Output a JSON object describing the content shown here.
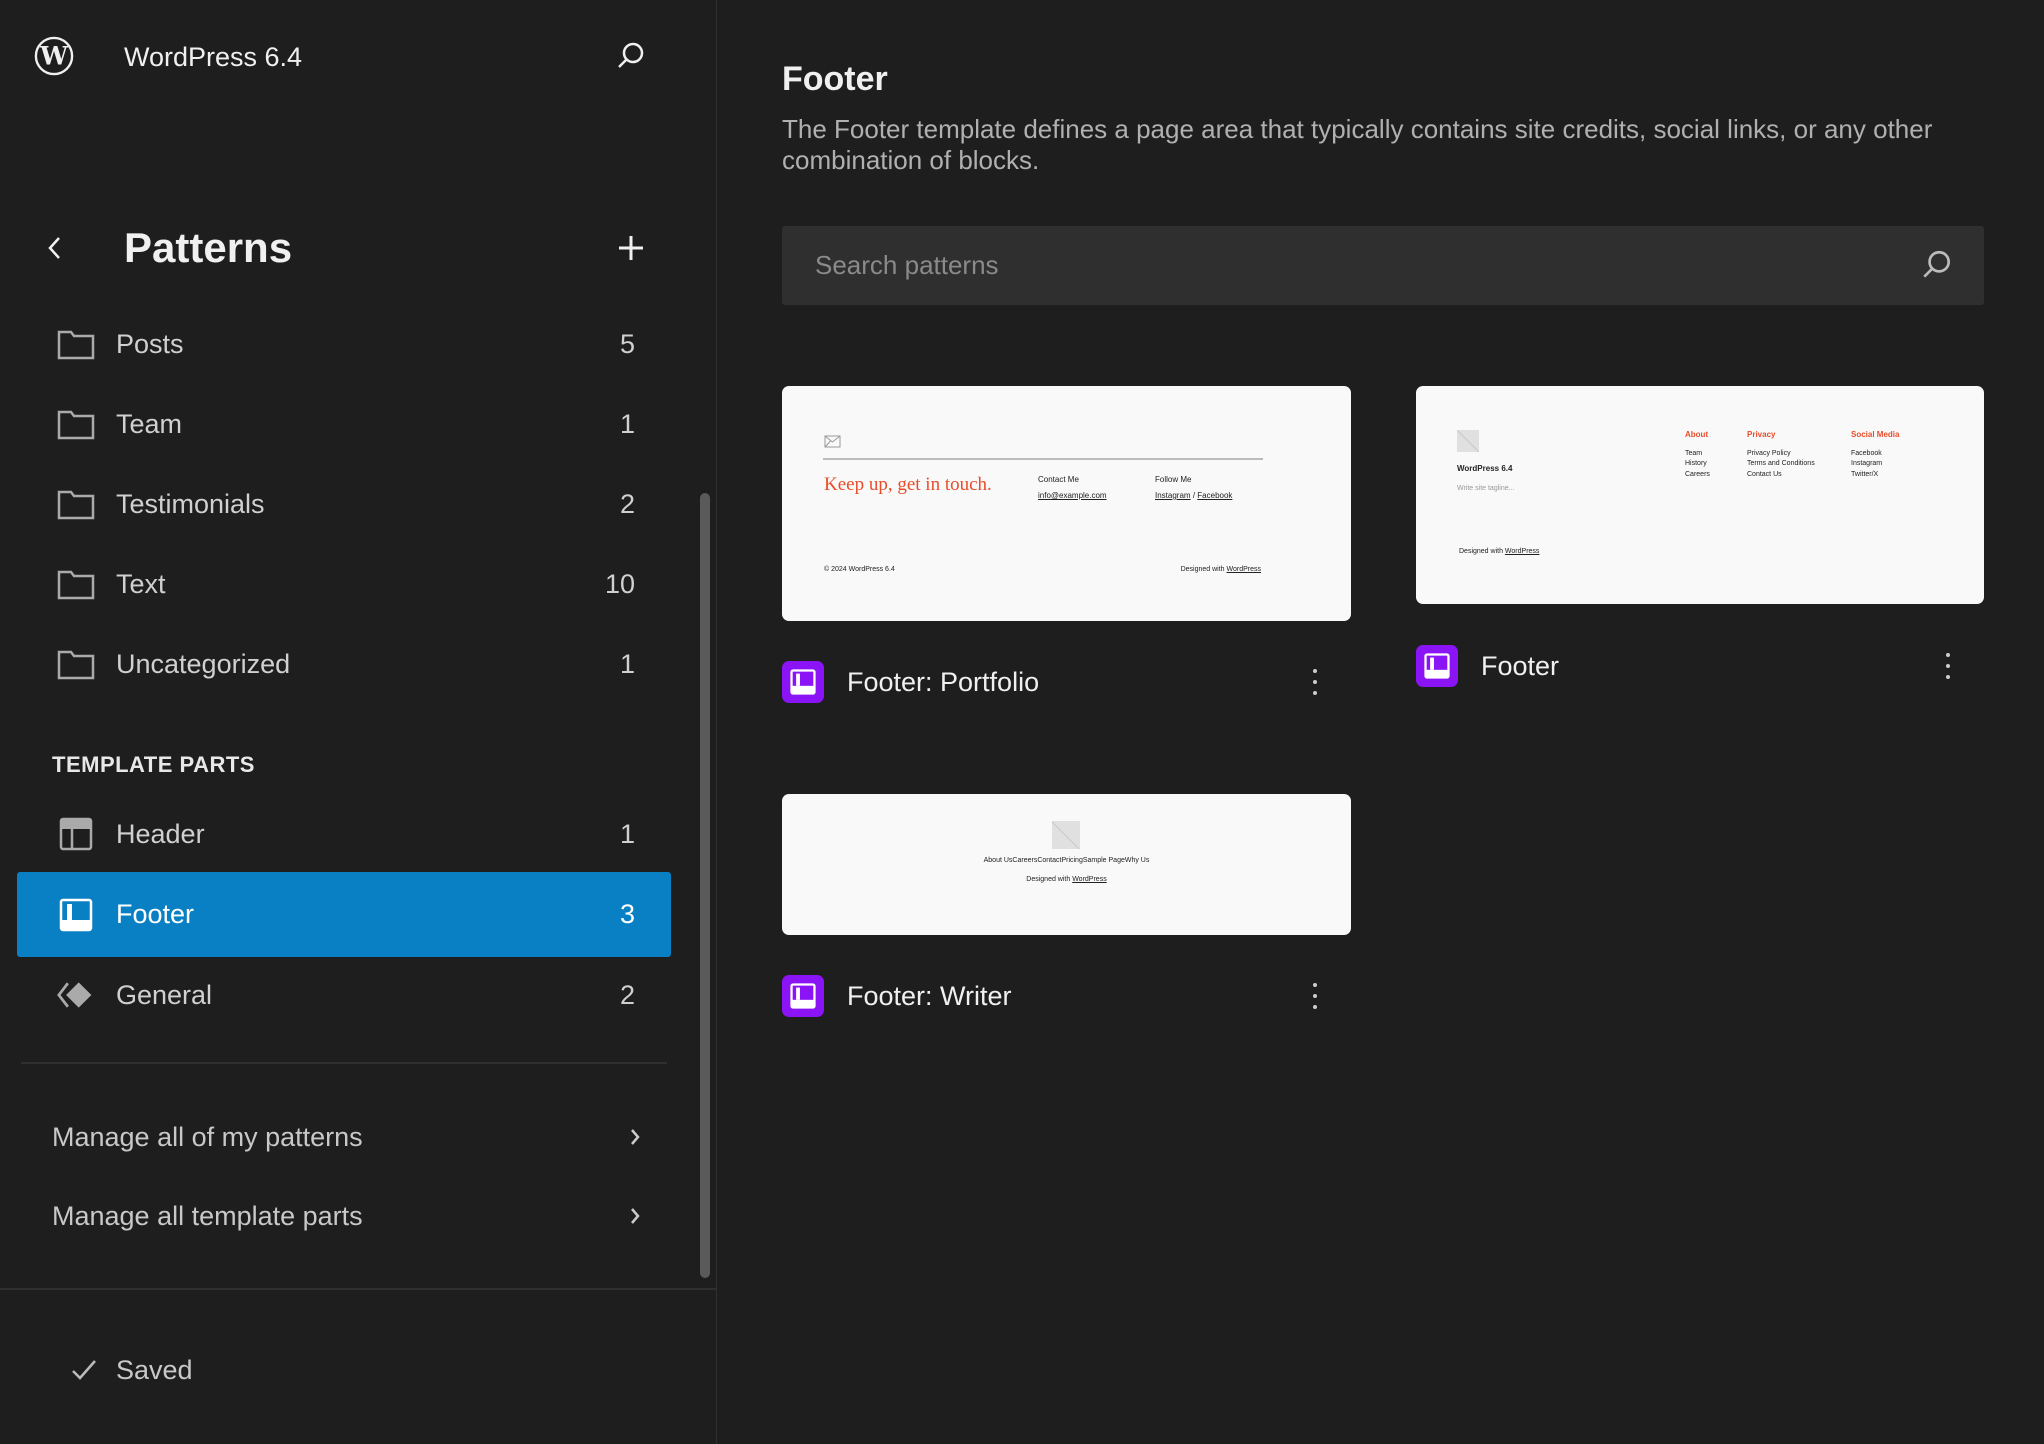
{
  "sidebar": {
    "site_title": "WordPress 6.4",
    "panel_title": "Patterns",
    "categories": [
      {
        "label": "Posts",
        "count": "5"
      },
      {
        "label": "Team",
        "count": "1"
      },
      {
        "label": "Testimonials",
        "count": "2"
      },
      {
        "label": "Text",
        "count": "10"
      },
      {
        "label": "Uncategorized",
        "count": "1"
      }
    ],
    "section_label": "TEMPLATE PARTS",
    "template_parts": [
      {
        "label": "Header",
        "count": "1"
      },
      {
        "label": "Footer",
        "count": "3",
        "active": true
      },
      {
        "label": "General",
        "count": "2"
      }
    ],
    "manage_patterns": "Manage all of my patterns",
    "manage_parts": "Manage all template parts",
    "status": "Saved"
  },
  "main": {
    "title": "Footer",
    "description": "The Footer template defines a page area that typically contains site credits, social links, or any other combination of blocks.",
    "search_placeholder": "Search patterns",
    "accent": "#0a80c4",
    "patterns": [
      {
        "label": "Footer: Portfolio",
        "preview": {
          "heading": "Keep up, get in touch.",
          "contact_label": "Contact Me",
          "email": "info@example.com",
          "follow_label": "Follow Me",
          "instagram": "Instagram",
          "sep": "/",
          "facebook": "Facebook",
          "copyright": "© 2024 WordPress 6.4",
          "designed": "Designed with",
          "wp": "WordPress"
        }
      },
      {
        "label": "Footer",
        "preview": {
          "site": "WordPress 6.4",
          "tagline": "Write site tagline...",
          "col1": "About",
          "col1_items": [
            "Team",
            "History",
            "Careers"
          ],
          "col2": "Privacy",
          "col2_items": [
            "Privacy Policy",
            "Terms and Conditions",
            "Contact Us"
          ],
          "col3": "Social Media",
          "col3_items": [
            "Facebook",
            "Instagram",
            "Twitter/X"
          ],
          "designed": "Designed with",
          "wp": "WordPress"
        }
      },
      {
        "label": "Footer: Writer",
        "preview": {
          "nav": "About UsCareersContactPricingSample PageWhy Us",
          "designed": "Designed with",
          "wp": "WordPress"
        }
      }
    ]
  }
}
